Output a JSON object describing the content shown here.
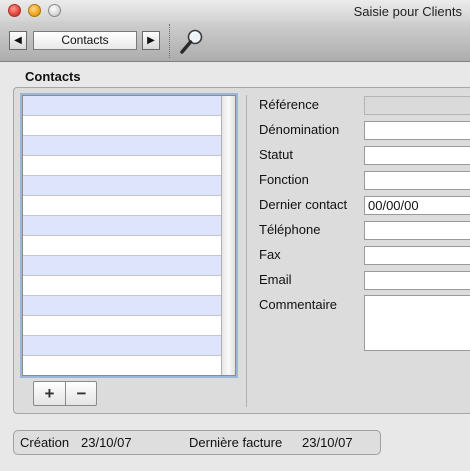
{
  "window": {
    "title": "Saisie pour Clients"
  },
  "toolbar": {
    "record_label": "Contacts",
    "prev_glyph": "◀",
    "next_glyph": "▶"
  },
  "section": {
    "title": "Contacts"
  },
  "list": {
    "add_glyph": "+",
    "remove_glyph": "−"
  },
  "fields": {
    "reference": {
      "label": "Référence",
      "value": ""
    },
    "denomination": {
      "label": "Dénomination",
      "value": ""
    },
    "statut": {
      "label": "Statut",
      "value": ""
    },
    "fonction": {
      "label": "Fonction",
      "value": ""
    },
    "dernier_contact": {
      "label": "Dernier contact",
      "value": "00/00/00"
    },
    "telephone": {
      "label": "Téléphone",
      "value": ""
    },
    "fax": {
      "label": "Fax",
      "value": ""
    },
    "email": {
      "label": "Email",
      "value": ""
    },
    "commentaire": {
      "label": "Commentaire",
      "value": ""
    }
  },
  "footer": {
    "creation_label": "Création",
    "creation_value": "23/10/07",
    "derniere_facture_label": "Dernière facture",
    "derniere_facture_value": "23/10/07"
  },
  "icons": {
    "search": "magnifier-icon"
  }
}
